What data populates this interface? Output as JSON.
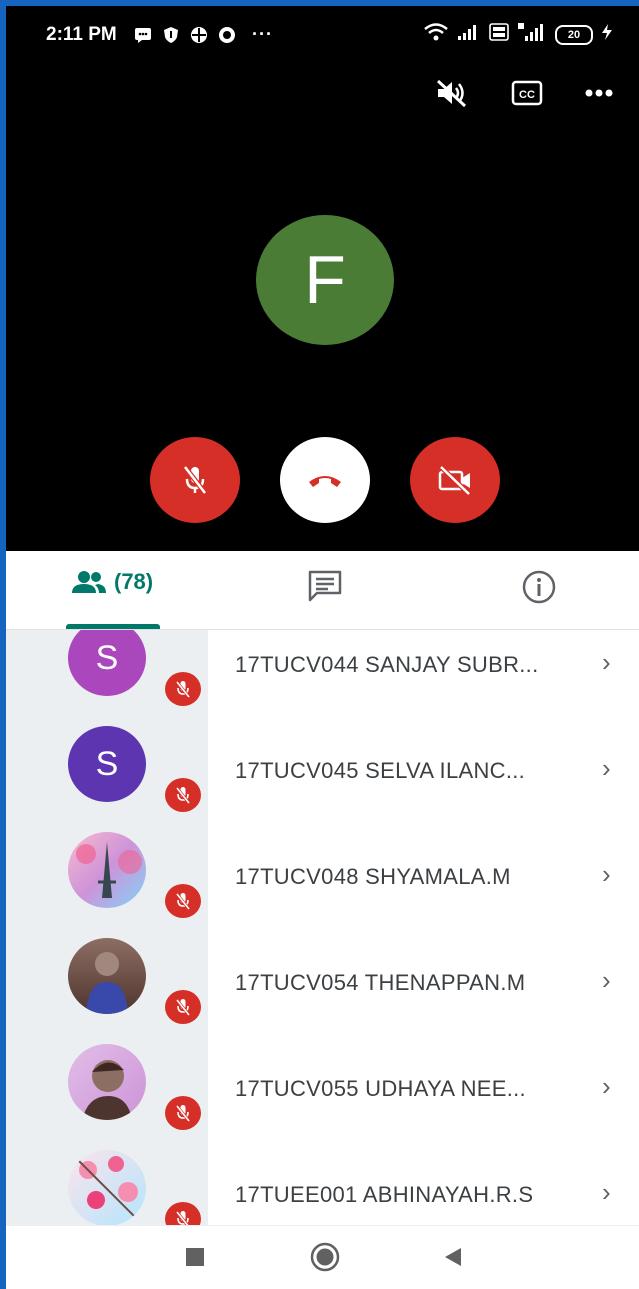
{
  "status_bar": {
    "time": "2:11 PM",
    "more": "···",
    "battery": "20",
    "icons_left": [
      "message-icon",
      "shield-icon",
      "grid-icon",
      "record-icon"
    ],
    "icons_right": [
      "wifi-icon",
      "signal-icon",
      "volte-icon",
      "signal-4g-icon",
      "battery-icon",
      "charging-icon"
    ]
  },
  "call": {
    "top_actions": [
      "speaker-off-icon",
      "captions-icon",
      "more-options-icon"
    ],
    "presenter_initial": "F",
    "presenter_color": "#4a7c35",
    "controls": [
      "mic-off-button",
      "end-call-button",
      "camera-off-button"
    ],
    "accent_red": "#d62f27"
  },
  "tabs": {
    "people_count": "(78)",
    "accent": "#00796b"
  },
  "participants": [
    {
      "name": "17TUCV044 SANJAY SUBR...",
      "initial": "S",
      "avatar_color": "#ab47bc"
    },
    {
      "name": "17TUCV045 SELVA ILANC...",
      "initial": "S",
      "avatar_color": "#5e35b1"
    },
    {
      "name": "17TUCV048 SHYAMALA.M",
      "initial": "",
      "avatar_color": "#f8bbd0"
    },
    {
      "name": "17TUCV054 THENAPPAN.M",
      "initial": "",
      "avatar_color": "#5d4037"
    },
    {
      "name": "17TUCV055 UDHAYA NEE...",
      "initial": "",
      "avatar_color": "#8d6e63"
    },
    {
      "name": "17TUEE001 ABHINAYAH.R.S",
      "initial": "",
      "avatar_color": "#f48fb1"
    }
  ],
  "chevron": "›",
  "nav": [
    "recents-button",
    "home-button",
    "back-button"
  ]
}
